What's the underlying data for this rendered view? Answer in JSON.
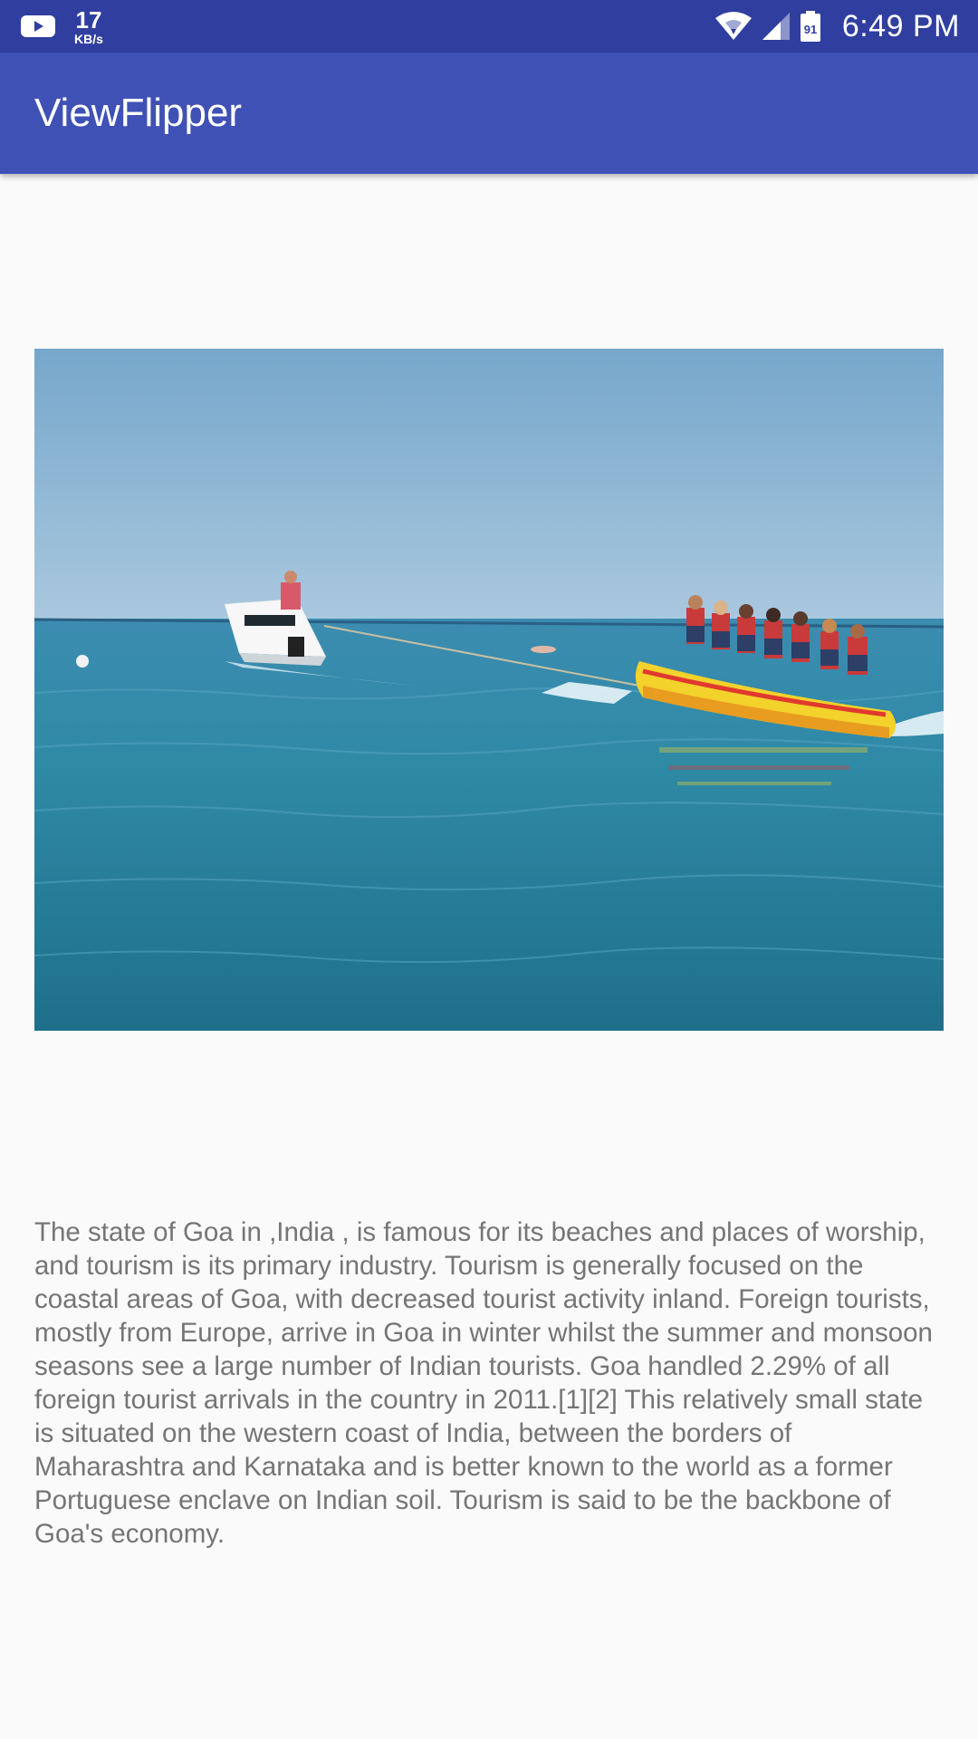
{
  "status_bar": {
    "net_speed_value": "17",
    "net_speed_unit": "KB/s",
    "time": "6:49 PM",
    "sim_label": "91",
    "icons": [
      "youtube-icon",
      "wifi-icon",
      "cell-signal-icon",
      "battery-icon"
    ]
  },
  "app_bar": {
    "title": "ViewFlipper"
  },
  "flipper": {
    "image_subject": "banana-boat-ride-photo"
  },
  "content": {
    "description": "The state of Goa in ,India , is famous for its beaches and places of worship, and tourism is its primary industry. Tourism is generally focused on the coastal areas of Goa, with decreased tourist activity inland. Foreign tourists, mostly from Europe, arrive in Goa in winter whilst the summer and monsoon seasons see a large number of Indian tourists. Goa handled 2.29% of all foreign tourist arrivals in the country in 2011.[1][2] This relatively small state is situated on the western coast of India, between the borders of Maharashtra and Karnataka and is better known to the world as a former Portuguese enclave on Indian soil. Tourism is said to be the backbone of Goa's economy."
  },
  "colors": {
    "status_bar": "#303f9f",
    "primary": "#3f51b5",
    "background": "#fafafa",
    "body_text": "#757575"
  }
}
